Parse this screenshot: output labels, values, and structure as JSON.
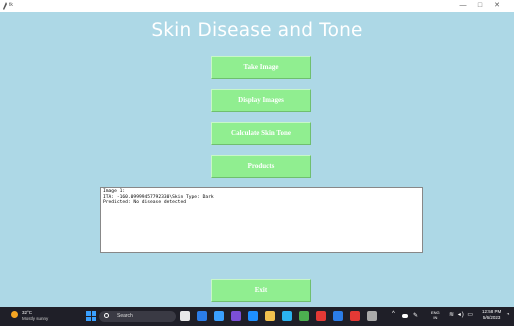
{
  "window": {
    "title": "tk",
    "minimize_glyph": "—",
    "maximize_glyph": "□",
    "close_glyph": "✕"
  },
  "main": {
    "heading": "Skin Disease and Tone",
    "buttons": {
      "take_image": "Take Image",
      "display_images": "Display Images",
      "calculate_skin_tone": "Calculate Skin Tone",
      "products": "Products",
      "exit": "Exit"
    },
    "output_lines": [
      "Image 1:",
      "ITA: -160.09999457792330\\Skin Type: Dark",
      "Predicted: No disease detected"
    ]
  },
  "taskbar": {
    "weather_temp": "32°C",
    "weather_desc": "Mostly sunny",
    "search_label": "Search",
    "lang_top": "ENG",
    "lang_bottom": "IN",
    "time": "12:58 PM",
    "date": "5/6/2023",
    "app_colors": [
      "#e8e8e8",
      "#2b7de9",
      "#3aa0ff",
      "#7b4fd6",
      "#1e90ff",
      "#f2c14e",
      "#2bb3f0",
      "#4caf50",
      "#e53935",
      "#2b7de9",
      "#e53935",
      "#aaaaaa"
    ]
  }
}
